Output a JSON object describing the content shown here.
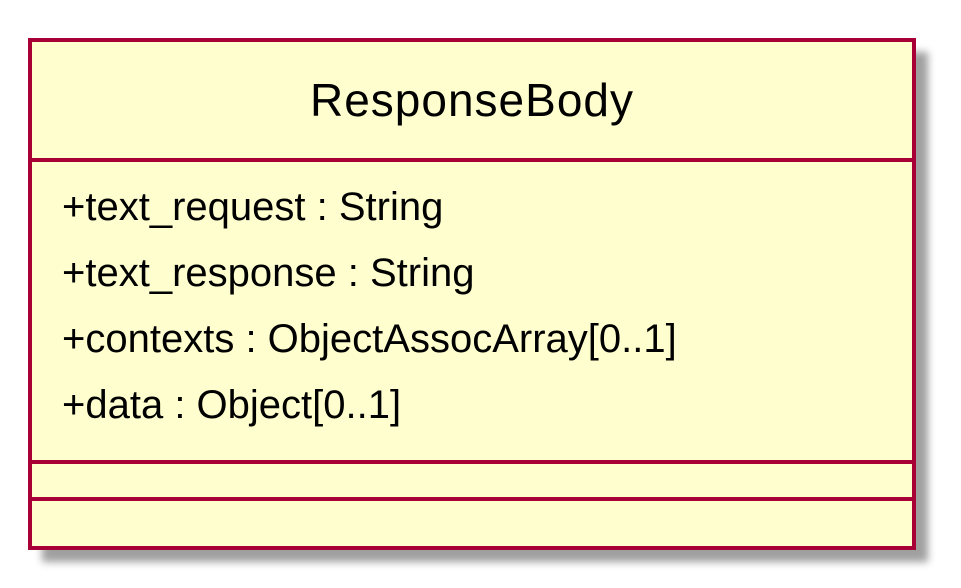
{
  "class": {
    "name": "ResponseBody",
    "attributes": [
      "+text_request : String",
      "+text_response : String",
      "+contexts : ObjectAssocArray[0..1]",
      "+data : Object[0..1]"
    ]
  },
  "colors": {
    "border": "#a80036",
    "fill": "#fefece",
    "shadow": "#8f8f8f"
  }
}
